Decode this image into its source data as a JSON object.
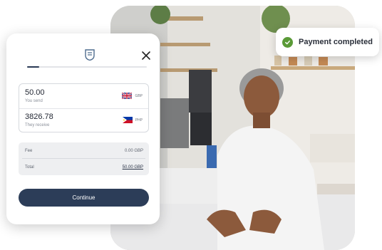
{
  "toast": {
    "text": "Payment completed"
  },
  "form": {
    "progress": 0.1,
    "send": {
      "amount": "50.00",
      "caption": "You send",
      "currency": "GBP"
    },
    "receive": {
      "amount": "3826.78",
      "caption": "They receive",
      "currency": "PHP"
    },
    "summary": [
      {
        "label": "Fee",
        "value": "0.00 GBP"
      },
      {
        "label": "Total",
        "value": "50.00 GBP"
      }
    ],
    "continue_label": "Continue"
  },
  "colors": {
    "primary": "#2c3d58",
    "success": "#5a9a37"
  }
}
